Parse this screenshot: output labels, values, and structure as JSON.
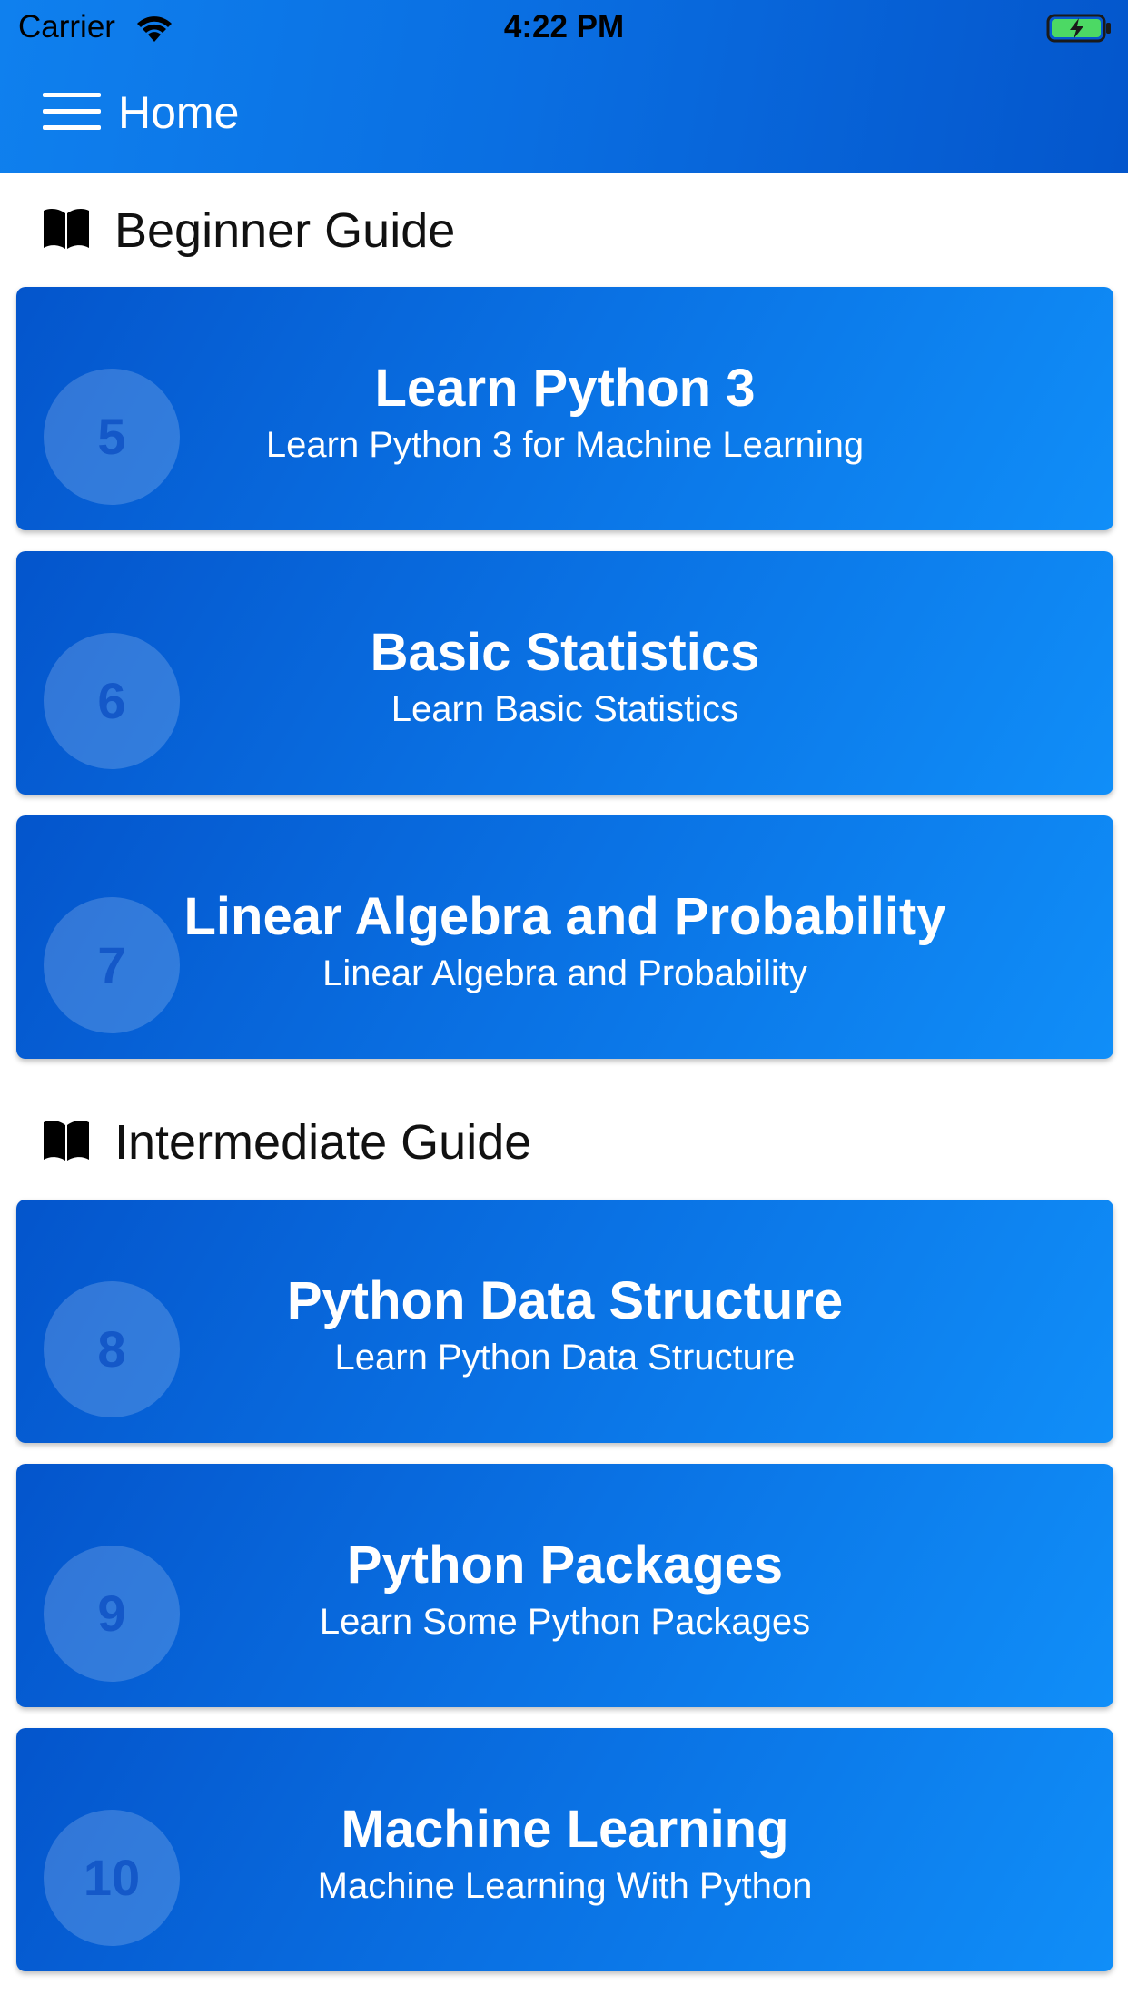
{
  "status_bar": {
    "carrier": "Carrier",
    "time": "4:22 PM",
    "icons": [
      "wifi-icon",
      "battery-charging-icon"
    ]
  },
  "nav": {
    "title": "Home",
    "menu_icon": "hamburger-menu-icon"
  },
  "colors": {
    "accent": "#0a6fe2",
    "card_gradient_start": "#0455cc",
    "card_gradient_end": "#108ef8",
    "battery_fill": "#4cd964"
  },
  "sections": [
    {
      "title": "Beginner Guide",
      "icon": "book-icon",
      "cards": [
        {
          "number": "5",
          "title": "Learn Python 3",
          "subtitle": "Learn Python 3 for Machine Learning"
        },
        {
          "number": "6",
          "title": "Basic Statistics",
          "subtitle": "Learn Basic Statistics"
        },
        {
          "number": "7",
          "title": "Linear Algebra and Probability",
          "subtitle": "Linear Algebra and Probability"
        }
      ]
    },
    {
      "title": "Intermediate Guide",
      "icon": "book-icon",
      "cards": [
        {
          "number": "8",
          "title": "Python Data Structure",
          "subtitle": "Learn Python Data Structure"
        },
        {
          "number": "9",
          "title": "Python Packages",
          "subtitle": "Learn Some Python Packages"
        },
        {
          "number": "10",
          "title": "Machine Learning",
          "subtitle": "Machine Learning With Python"
        }
      ]
    }
  ]
}
